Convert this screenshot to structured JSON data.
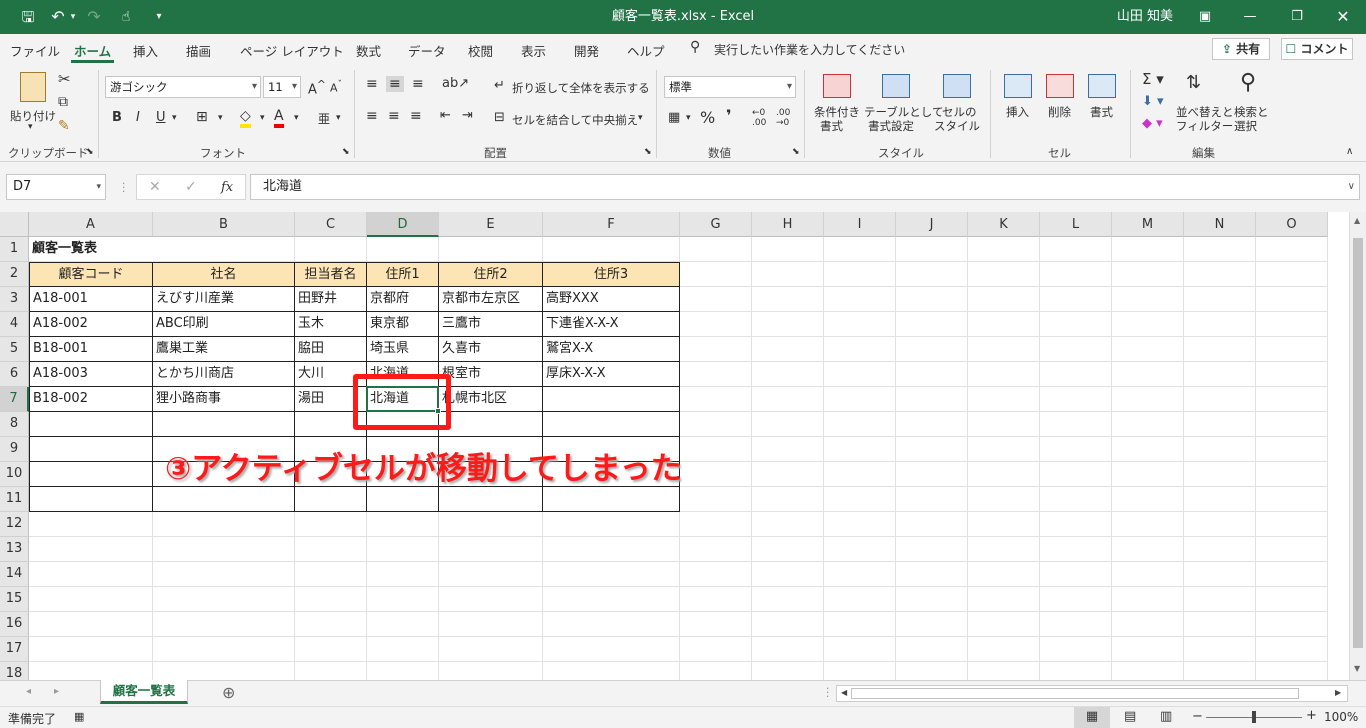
{
  "window": {
    "title": "顧客一覧表.xlsx  -  Excel",
    "user": "山田 知美"
  },
  "menu": {
    "tabs": [
      "ファイル",
      "ホーム",
      "挿入",
      "描画",
      "ページ レイアウト",
      "数式",
      "データ",
      "校閲",
      "表示",
      "開発",
      "ヘルプ"
    ],
    "search_placeholder": "実行したい作業を入力してください",
    "share": "共有",
    "comment": "コメント"
  },
  "ribbon": {
    "clipboard": {
      "paste": "貼り付け",
      "label": "クリップボード"
    },
    "font": {
      "name": "游ゴシック",
      "size": "11",
      "bold": "B",
      "italic": "I",
      "underline": "U",
      "label": "フォント"
    },
    "alignment": {
      "wrap": "折り返して全体を表示する",
      "merge": "セルを結合して中央揃え",
      "label": "配置"
    },
    "number": {
      "format": "標準",
      "label": "数値"
    },
    "styles": {
      "cond_format": [
        "条件付き",
        "書式"
      ],
      "table_format": [
        "テーブルとして",
        "書式設定"
      ],
      "cell_styles": [
        "セルの",
        "スタイル"
      ],
      "label": "スタイル"
    },
    "cells": {
      "insert": "挿入",
      "delete": "削除",
      "format": "書式",
      "label": "セル"
    },
    "editing": {
      "sort": [
        "並べ替えと",
        "フィルター"
      ],
      "find": [
        "検索と",
        "選択"
      ],
      "label": "編集"
    }
  },
  "formula_bar": {
    "name_box": "D7",
    "content": "北海道",
    "fx": "fx"
  },
  "sheet": {
    "columns": [
      "A",
      "B",
      "C",
      "D",
      "E",
      "F",
      "G",
      "H",
      "I",
      "J",
      "K",
      "L",
      "M",
      "N",
      "O"
    ],
    "rows": [
      "1",
      "2",
      "3",
      "4",
      "5",
      "6",
      "7",
      "8",
      "9",
      "10",
      "11",
      "12",
      "13",
      "14",
      "15",
      "16",
      "17",
      "18"
    ],
    "title": "顧客一覧表",
    "headers": [
      "顧客コード",
      "社名",
      "担当者名",
      "住所1",
      "住所2",
      "住所3"
    ],
    "data": [
      [
        "A18-001",
        "えびす川産業",
        "田野井",
        "京都府",
        "京都市左京区",
        "高野XXX"
      ],
      [
        "A18-002",
        "ABC印刷",
        "玉木",
        "東京都",
        "三鷹市",
        "下連雀X-X-X"
      ],
      [
        "B18-001",
        "鷹巣工業",
        "脇田",
        "埼玉県",
        "久喜市",
        "鷲宮X-X"
      ],
      [
        "A18-003",
        "とかち川商店",
        "大川",
        "北海道",
        "根室市",
        "厚床X-X-X"
      ],
      [
        "B18-002",
        "狸小路商事",
        "湯田",
        "北海道",
        "札幌市北区",
        ""
      ]
    ]
  },
  "sheet_tab": "顧客一覧表",
  "status": {
    "ready": "準備完了",
    "zoom": "100%"
  },
  "annotation": "③アクティブセルが移動してしまった"
}
